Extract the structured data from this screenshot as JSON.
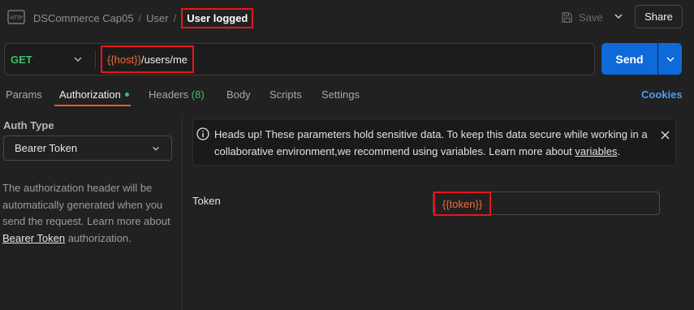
{
  "header": {
    "breadcrumb": [
      "DSCommerce Cap05",
      "User"
    ],
    "separator": "/",
    "request_name": "User logged",
    "save_label": "Save",
    "share_label": "Share"
  },
  "request": {
    "method": "GET",
    "url_variable": "{{host}}",
    "url_path": "/users/me",
    "send_label": "Send"
  },
  "tabs": [
    {
      "label": "Params",
      "active": false
    },
    {
      "label": "Authorization",
      "active": true,
      "indicator": "green-dot"
    },
    {
      "label": "Headers",
      "count": "(8)",
      "active": false
    },
    {
      "label": "Body",
      "active": false
    },
    {
      "label": "Scripts",
      "active": false
    },
    {
      "label": "Settings",
      "active": false
    }
  ],
  "cookies_label": "Cookies",
  "auth": {
    "type_label": "Auth Type",
    "selected_type": "Bearer Token",
    "description_prefix": "The authorization header will be automatically generated when you send the request. Learn more about ",
    "description_link": "Bearer Token",
    "description_suffix": " authorization."
  },
  "alert": {
    "text_prefix": "Heads up! These parameters hold sensitive data. To keep this data secure while working in a collaborative environment,we recommend using variables. Learn more about ",
    "link": "variables",
    "text_suffix": "."
  },
  "token": {
    "label": "Token",
    "value": "{{token}}"
  },
  "colors": {
    "background": "#212121",
    "accent_orange": "#ef5b25",
    "send_blue": "#0e6ad8",
    "method_green": "#3fbd6b",
    "variable_orange": "#f26b3a",
    "highlight_red": "#e8161b"
  }
}
